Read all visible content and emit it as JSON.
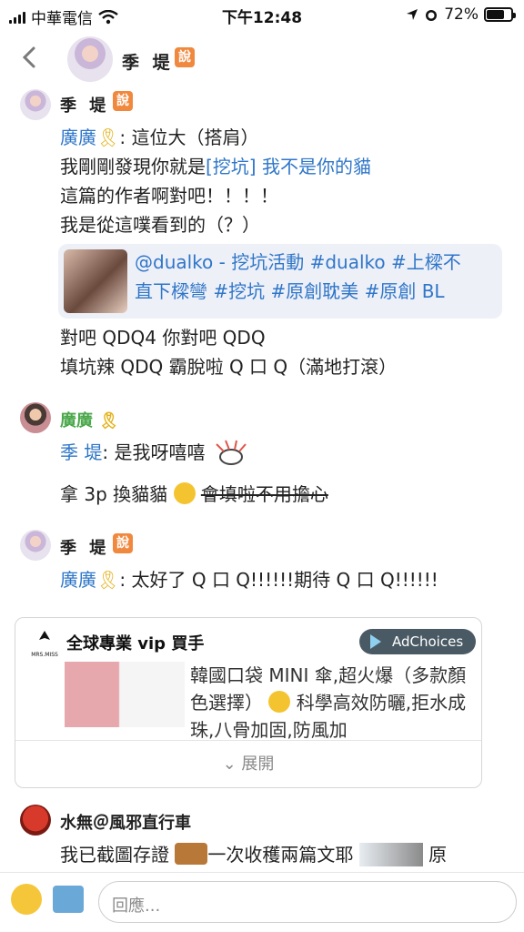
{
  "status_bar": {
    "carrier": "中華電信",
    "time": "下午12:48",
    "battery_percent": "72%",
    "battery_level": 0.72
  },
  "header": {
    "user_name": "季 堤",
    "badge": "說"
  },
  "messages": [
    {
      "user": "季 堤",
      "badge": "說",
      "mention": "廣廣",
      "lines": [
        ": 這位大（搭肩）",
        "我剛剛發現你就是",
        "[挖坑] 我不是你的貓",
        "這篇的作者啊對吧！！！！",
        "我是從這噗看到的（？）"
      ],
      "link_card": {
        "line1": "@dualko - 挖坑活動 #dualko #上樑不",
        "line2": "直下樑彎 #挖坑 #原創耽美 #原創 BL"
      },
      "after": [
        "對吧 QDQ4 你對吧 QDQ",
        "填坑辣 QDQ 霸脫啦 Q 口 Q（滿地打滾）"
      ]
    },
    {
      "user": "廣廣",
      "mention": "季 堤",
      "text1": ": 是我呀嘻嘻",
      "text2": "拿 3p 換貓貓",
      "strike": "會填啦不用擔心"
    },
    {
      "user": "季 堤",
      "badge": "說",
      "mention": "廣廣",
      "text": ": 太好了 Q 口 Q!!!!!!期待 Q 口 Q!!!!!!"
    },
    {
      "user": "水無＠風邪直行車",
      "text": "我已截圖存證",
      "text_after": "一次收穫兩篇文耶",
      "text_tail": "原"
    }
  ],
  "ad": {
    "brand": "全球專業 vip 買手",
    "adchoices": "AdChoices",
    "logo_text": "MRS.MISS",
    "desc": "韓國口袋 MINI 傘,超火爆（多款顏色選擇）",
    "desc2": "科學高效防曬,拒水成珠,八骨加固,防風加",
    "expand": "展開"
  },
  "composer": {
    "placeholder": "回應..."
  }
}
